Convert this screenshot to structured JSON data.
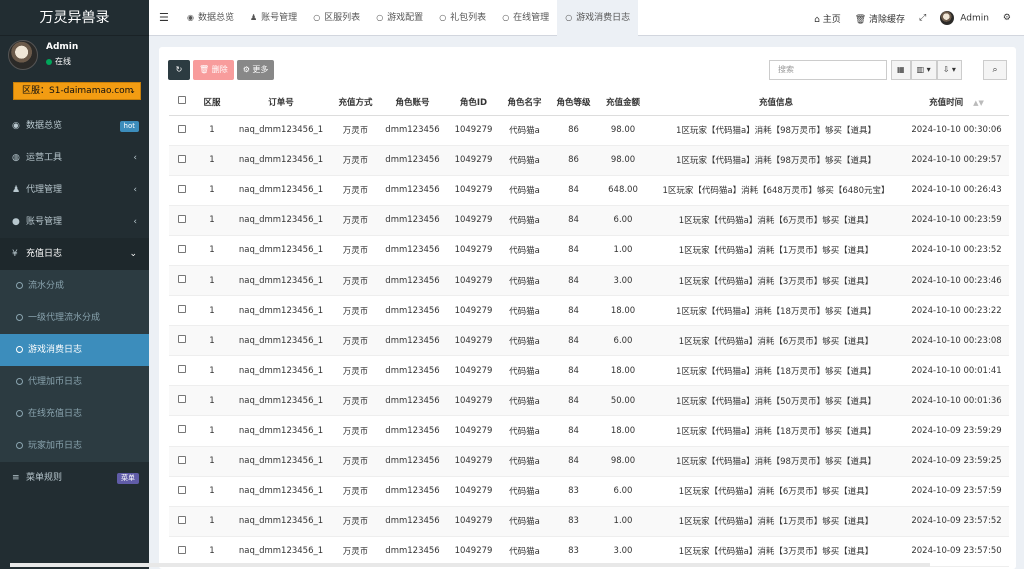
{
  "app": {
    "title": "万灵异兽录"
  },
  "user": {
    "name": "Admin",
    "status": "在线"
  },
  "region": {
    "label": "区服：S1-daimamao.com"
  },
  "sidebar": {
    "items": [
      {
        "label": "数据总览",
        "icon": "dashboard-icon",
        "badge": "hot"
      },
      {
        "label": "运营工具",
        "icon": "gamepad-icon"
      },
      {
        "label": "代理管理",
        "icon": "users-icon"
      },
      {
        "label": "账号管理",
        "icon": "user-circle-icon"
      },
      {
        "label": "充值日志",
        "icon": "yen-icon"
      }
    ],
    "sub_items": [
      {
        "label": "流水分成"
      },
      {
        "label": "一级代理流水分成"
      },
      {
        "label": "游戏消费日志"
      },
      {
        "label": "代理加币日志"
      },
      {
        "label": "在线充值日志"
      },
      {
        "label": "玩家加币日志"
      }
    ],
    "menu_rule": {
      "label": "菜单规则",
      "badge": "菜单"
    }
  },
  "tabs": [
    {
      "label": "数据总览",
      "icon": "dashboard-icon"
    },
    {
      "label": "账号管理",
      "icon": "user-icon"
    },
    {
      "label": "区服列表",
      "icon": "circle-icon"
    },
    {
      "label": "游戏配置",
      "icon": "circle-icon"
    },
    {
      "label": "礼包列表",
      "icon": "circle-icon"
    },
    {
      "label": "在线管理",
      "icon": "circle-icon"
    },
    {
      "label": "游戏消费日志",
      "icon": "circle-icon"
    }
  ],
  "topright": {
    "home": "主页",
    "clear_cache": "清除缓存",
    "user": "Admin"
  },
  "toolbar": {
    "delete": "删除",
    "more": "更多",
    "search_placeholder": "搜索"
  },
  "table": {
    "headers": [
      "区服",
      "订单号",
      "充值方式",
      "角色账号",
      "角色ID",
      "角色名字",
      "角色等级",
      "充值金额",
      "充值信息",
      "充值时间"
    ],
    "rows": [
      [
        "1",
        "naq_dmm123456_1",
        "万灵币",
        "dmm123456",
        "1049279",
        "代码猫a",
        "86",
        "98.00",
        "1区玩家【代码猫a】消耗【98万灵币】够买【道具】",
        "2024-10-10 00:30:06"
      ],
      [
        "1",
        "naq_dmm123456_1",
        "万灵币",
        "dmm123456",
        "1049279",
        "代码猫a",
        "86",
        "98.00",
        "1区玩家【代码猫a】消耗【98万灵币】够买【道具】",
        "2024-10-10 00:29:57"
      ],
      [
        "1",
        "naq_dmm123456_1",
        "万灵币",
        "dmm123456",
        "1049279",
        "代码猫a",
        "84",
        "648.00",
        "1区玩家【代码猫a】消耗【648万灵币】够买【6480元宝】",
        "2024-10-10 00:26:43"
      ],
      [
        "1",
        "naq_dmm123456_1",
        "万灵币",
        "dmm123456",
        "1049279",
        "代码猫a",
        "84",
        "6.00",
        "1区玩家【代码猫a】消耗【6万灵币】够买【道具】",
        "2024-10-10 00:23:59"
      ],
      [
        "1",
        "naq_dmm123456_1",
        "万灵币",
        "dmm123456",
        "1049279",
        "代码猫a",
        "84",
        "1.00",
        "1区玩家【代码猫a】消耗【1万灵币】够买【道具】",
        "2024-10-10 00:23:52"
      ],
      [
        "1",
        "naq_dmm123456_1",
        "万灵币",
        "dmm123456",
        "1049279",
        "代码猫a",
        "84",
        "3.00",
        "1区玩家【代码猫a】消耗【3万灵币】够买【道具】",
        "2024-10-10 00:23:46"
      ],
      [
        "1",
        "naq_dmm123456_1",
        "万灵币",
        "dmm123456",
        "1049279",
        "代码猫a",
        "84",
        "18.00",
        "1区玩家【代码猫a】消耗【18万灵币】够买【道具】",
        "2024-10-10 00:23:22"
      ],
      [
        "1",
        "naq_dmm123456_1",
        "万灵币",
        "dmm123456",
        "1049279",
        "代码猫a",
        "84",
        "6.00",
        "1区玩家【代码猫a】消耗【6万灵币】够买【道具】",
        "2024-10-10 00:23:08"
      ],
      [
        "1",
        "naq_dmm123456_1",
        "万灵币",
        "dmm123456",
        "1049279",
        "代码猫a",
        "84",
        "18.00",
        "1区玩家【代码猫a】消耗【18万灵币】够买【道具】",
        "2024-10-10 00:01:41"
      ],
      [
        "1",
        "naq_dmm123456_1",
        "万灵币",
        "dmm123456",
        "1049279",
        "代码猫a",
        "84",
        "50.00",
        "1区玩家【代码猫a】消耗【50万灵币】够买【道具】",
        "2024-10-10 00:01:36"
      ],
      [
        "1",
        "naq_dmm123456_1",
        "万灵币",
        "dmm123456",
        "1049279",
        "代码猫a",
        "84",
        "18.00",
        "1区玩家【代码猫a】消耗【18万灵币】够买【道具】",
        "2024-10-09 23:59:29"
      ],
      [
        "1",
        "naq_dmm123456_1",
        "万灵币",
        "dmm123456",
        "1049279",
        "代码猫a",
        "84",
        "98.00",
        "1区玩家【代码猫a】消耗【98万灵币】够买【道具】",
        "2024-10-09 23:59:25"
      ],
      [
        "1",
        "naq_dmm123456_1",
        "万灵币",
        "dmm123456",
        "1049279",
        "代码猫a",
        "83",
        "6.00",
        "1区玩家【代码猫a】消耗【6万灵币】够买【道具】",
        "2024-10-09 23:57:59"
      ],
      [
        "1",
        "naq_dmm123456_1",
        "万灵币",
        "dmm123456",
        "1049279",
        "代码猫a",
        "83",
        "1.00",
        "1区玩家【代码猫a】消耗【1万灵币】够买【道具】",
        "2024-10-09 23:57:52"
      ],
      [
        "1",
        "naq_dmm123456_1",
        "万灵币",
        "dmm123456",
        "1049279",
        "代码猫a",
        "83",
        "3.00",
        "1区玩家【代码猫a】消耗【3万灵币】够买【道具】",
        "2024-10-09 23:57:50"
      ]
    ]
  },
  "colors": {
    "sidebar_bg": "#222d32",
    "active": "#3c8dbc",
    "region": "#f39c12",
    "delete_btn": "#f89c9c"
  }
}
